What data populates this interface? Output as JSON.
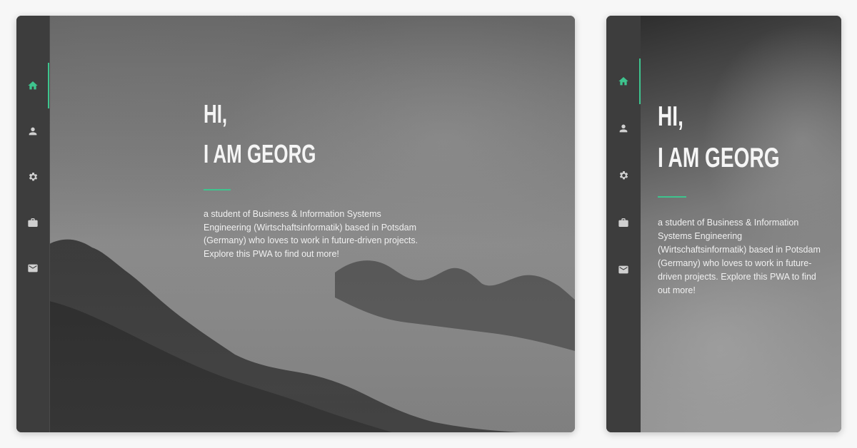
{
  "greeting": {
    "line1": "HI,",
    "line2": "I AM GEORG",
    "bio": "a student of Business & Information Systems Engineering (Wirtschaftsinformatik) based in Potsdam (Germany) who loves to work in future-driven projects. Explore this PWA to find out more!"
  },
  "nav": {
    "items": [
      {
        "icon": "home-icon",
        "active": true
      },
      {
        "icon": "person-icon",
        "active": false
      },
      {
        "icon": "gear-icon",
        "active": false
      },
      {
        "icon": "briefcase-icon",
        "active": false
      },
      {
        "icon": "mail-icon",
        "active": false
      }
    ]
  },
  "colors": {
    "accent": "#3ec48e",
    "sidebar": "#3d3d3d",
    "icon": "#d0d0d0"
  }
}
